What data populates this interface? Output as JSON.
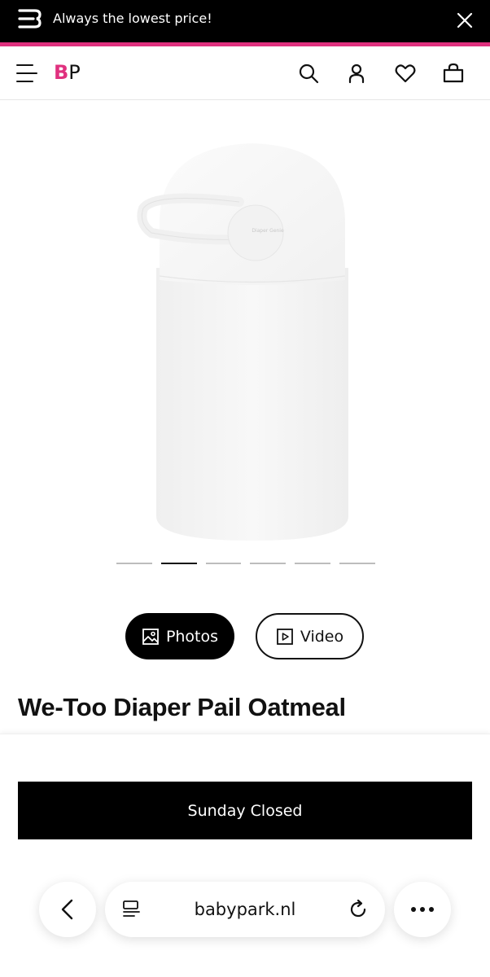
{
  "promo": {
    "text": "Always the lowest price!",
    "accent_color": "#e0317f"
  },
  "header": {
    "brand_b": "B",
    "brand_p": "P",
    "brand_color": "#e0317f",
    "icons": [
      "menu-icon",
      "search-icon",
      "account-icon",
      "heart-icon",
      "bag-icon"
    ]
  },
  "product": {
    "title": "We-Too Diaper Pail Oatmeal",
    "image_brand_mark": "Diaper Genie",
    "carousel": {
      "count": 6,
      "active_index": 1
    }
  },
  "media_toggle": {
    "photos_label": "Photos",
    "video_label": "Video",
    "selected": "Photos"
  },
  "store_notice": {
    "text": "Sunday Closed"
  },
  "browser": {
    "url": "babypark.nl",
    "icons": [
      "back-icon",
      "reader-icon",
      "reload-icon",
      "more-icon"
    ]
  }
}
